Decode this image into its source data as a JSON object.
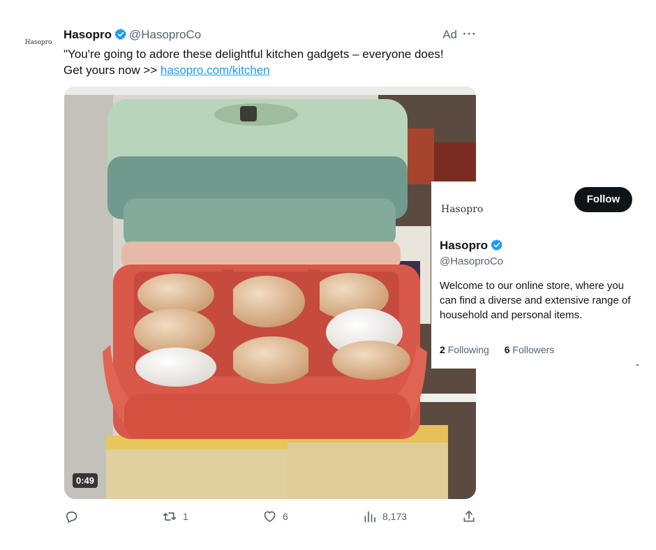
{
  "tweet": {
    "avatar_text": "Hasopro",
    "display_name": "Hasopro",
    "handle": "@HasoproCo",
    "ad_label": "Ad",
    "more": "···",
    "text_line1": "\"You're going to adore these delightful kitchen gadgets – everyone does!",
    "text_line2_prefix": "Get yours now >> ",
    "link": "hasopro.com/kitchen",
    "video_duration": "0:49"
  },
  "actions": {
    "reply_count": "",
    "retweet_count": "1",
    "like_count": "6",
    "views_count": "8,173"
  },
  "profile_card": {
    "logo_text": "Hasopro",
    "follow_label": "Follow",
    "name": "Hasopro",
    "handle": "@HasoproCo",
    "bio": "Welcome to our online store, where you can find a diverse and extensive range of household and personal items.",
    "following_count": "2",
    "following_label": "Following",
    "followers_count": "6",
    "followers_label": "Followers"
  },
  "colors": {
    "verified_blue": "#1d9bf0",
    "link_blue": "#1d9bf0",
    "secondary_text": "#536471",
    "follow_button_bg": "#0f1419"
  },
  "icons": [
    "verified-badge-icon",
    "more-icon",
    "reply-icon",
    "retweet-icon",
    "like-icon",
    "views-icon",
    "share-icon"
  ]
}
